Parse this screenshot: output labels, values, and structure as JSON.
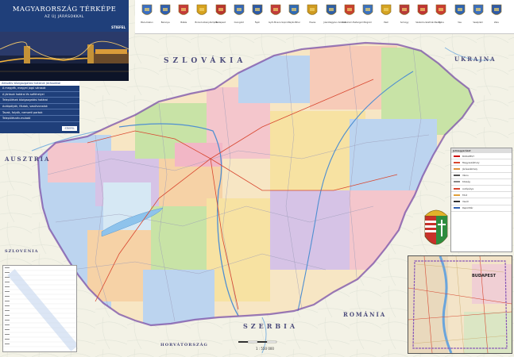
{
  "header": {
    "title": "MAGYARORSZÁG TÉRKÉPE",
    "subtitle": "AZ ÚJ JÁRÁSOKKAL",
    "publisher": "STIEFEL"
  },
  "info_panel": {
    "heading": "Aktuális közigazgatási határok járásokkal",
    "items": [
      "A megyék, megyei jogú városok",
      "A járások határai és székhelyei",
      "Települések közigazgatási határai",
      "Autópályák, főutak, vasútvonalak",
      "Tavak, folyók, nemzeti parkok",
      "Településnév-mutató"
    ],
    "button": "STIEFEL"
  },
  "countries": {
    "north": "SZLOVÁKIA",
    "northeast": "UKRAJNA",
    "west": "AUSZTRIA",
    "southwest": "SZLOVÉNIA",
    "south": "SZERBIA",
    "southeast": "ROMÁNIA",
    "south_croatia": "HORVÁTORSZÁG"
  },
  "crests": [
    {
      "name": "Bács-Kiskun",
      "color": "#3a6fc4"
    },
    {
      "name": "Baranya",
      "color": "#2f5fb0"
    },
    {
      "name": "Békés",
      "color": "#c43a3a"
    },
    {
      "name": "Borsod-Abaúj-Zemplén",
      "color": "#d6a21e"
    },
    {
      "name": "Budapest",
      "color": "#b8342f"
    },
    {
      "name": "Csongrád",
      "color": "#3468b8"
    },
    {
      "name": "Fejér",
      "color": "#2c5aa8"
    },
    {
      "name": "Győr-Moson-Sopron",
      "color": "#c23b3b"
    },
    {
      "name": "Hajdú-Bihar",
      "color": "#2f6ab5"
    },
    {
      "name": "Heves",
      "color": "#cf9b20"
    },
    {
      "name": "Jász-Nagykun-Szolnok",
      "color": "#2e5fa6"
    },
    {
      "name": "Komárom-Esztergom",
      "color": "#c8402f"
    },
    {
      "name": "Nógrád",
      "color": "#3a72c0"
    },
    {
      "name": "Pest",
      "color": "#d4a322"
    },
    {
      "name": "Somogy",
      "color": "#b83a3a"
    },
    {
      "name": "Szabolcs-Szatmár-Bereg",
      "color": "#bf3434"
    },
    {
      "name": "Tolna",
      "color": "#c93c32"
    },
    {
      "name": "Vas",
      "color": "#2e64b2"
    },
    {
      "name": "Veszprém",
      "color": "#3a6fbf"
    },
    {
      "name": "Zala",
      "color": "#2f5aa6"
    }
  ],
  "legend": {
    "title": "Jelmagyarázat",
    "items": [
      "BUDAPEST",
      "Megyeszékhely",
      "Járásszékhely",
      "Város",
      "Község",
      "Autópálya",
      "Főút",
      "Vasút",
      "Repülőtér"
    ]
  },
  "inset": {
    "title": "BUDAPEST"
  },
  "scale": {
    "label": "1 : 550 000"
  }
}
